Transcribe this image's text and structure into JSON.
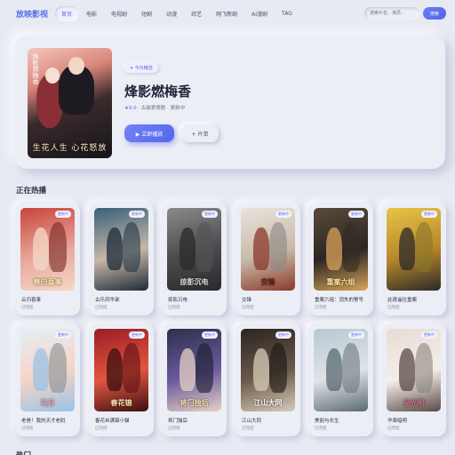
{
  "header": {
    "logo": "放映影视",
    "nav": [
      "首页",
      "电影",
      "电视剧",
      "短剧",
      "动漫",
      "综艺",
      "网飞新剧",
      "AI漫剧",
      "TAG"
    ],
    "active_index": 0,
    "search_placeholder": "搜索片名、演员…",
    "search_button": "搜索"
  },
  "hero": {
    "tag": "✦ 今日精选",
    "title": "烽影燃梅香",
    "rating": "★9.0",
    "meta": " · 古装爱情剧 · 更新中",
    "play_label": "▶ 立即播放",
    "list_label": "+ 片单",
    "poster_text": "生花人生 心花怒放",
    "poster_vertical": "烽影燃梅香"
  },
  "sections": {
    "hot_title": "正在热播",
    "next_title": "热门"
  },
  "cards": [
    {
      "title": "云归喜事",
      "sub": "已完结",
      "badge": "更新中",
      "colors": [
        "#c8453c",
        "#e9a79b",
        "#f4d9c8"
      ],
      "text": "春归喜事",
      "textColor": "#ffe7a8"
    },
    {
      "title": "古乐风华录",
      "sub": "已完结",
      "badge": "更新中",
      "colors": [
        "#3a5f7a",
        "#c7b7a6",
        "#1e2b3a"
      ],
      "text": "",
      "textColor": "#fff"
    },
    {
      "title": "掠影沉电",
      "sub": "已完结",
      "badge": "更新中",
      "colors": [
        "#8a8a8c",
        "#4a4a4d",
        "#2a2a2c"
      ],
      "text": "掠影沉电",
      "textColor": "#ddd"
    },
    {
      "title": "交锋",
      "sub": "已完结",
      "badge": "更新中",
      "colors": [
        "#e9e3dc",
        "#c9b9a9",
        "#8a3a2a"
      ],
      "text": "交锋",
      "textColor": "#6b1f14"
    },
    {
      "title": "重案六组：消失的警号",
      "sub": "已完结",
      "badge": "更新中",
      "colors": [
        "#5a4a3a",
        "#2a2622",
        "#d9a35a"
      ],
      "text": "重案六组",
      "textColor": "#ffe6a3"
    },
    {
      "title": "此夜遥往重案",
      "sub": "已完结",
      "badge": "更新中",
      "colors": [
        "#e6c548",
        "#b8862a",
        "#2a2a2a"
      ],
      "text": "",
      "textColor": "#222"
    },
    {
      "title": "老爸！我的天才老妈",
      "sub": "已完结",
      "badge": "更新中",
      "colors": [
        "#e6eef6",
        "#f4d4c6",
        "#9ac2e6"
      ],
      "text": "花月",
      "textColor": "#f2a9b9"
    },
    {
      "title": "春花丝满锦小猫",
      "sub": "已完结",
      "badge": "更新中",
      "colors": [
        "#9a1d24",
        "#e2563f",
        "#3b0f12"
      ],
      "text": "春花锦",
      "textColor": "#ffe3b0"
    },
    {
      "title": "将门独后",
      "sub": "已完结",
      "badge": "更新中",
      "colors": [
        "#2a2f4a",
        "#6c5aa0",
        "#e6d2c2"
      ],
      "text": "将门独后",
      "textColor": "#f3e0a8"
    },
    {
      "title": "江山大同",
      "sub": "已完结",
      "badge": "更新中",
      "colors": [
        "#2a2420",
        "#6a5a4a",
        "#d8cbb8"
      ],
      "text": "江山大同",
      "textColor": "#fff"
    },
    {
      "title": "美丽与长生",
      "sub": "已完结",
      "badge": "更新中",
      "colors": [
        "#b8c8d2",
        "#dfe3e6",
        "#5a6a72"
      ],
      "text": "",
      "textColor": "#fff"
    },
    {
      "title": "华章暗明",
      "sub": "已完结",
      "badge": "更新中",
      "colors": [
        "#e8dcd4",
        "#f4eeea",
        "#5a4a46"
      ],
      "text": "星光明",
      "textColor": "#c96f8a"
    }
  ]
}
